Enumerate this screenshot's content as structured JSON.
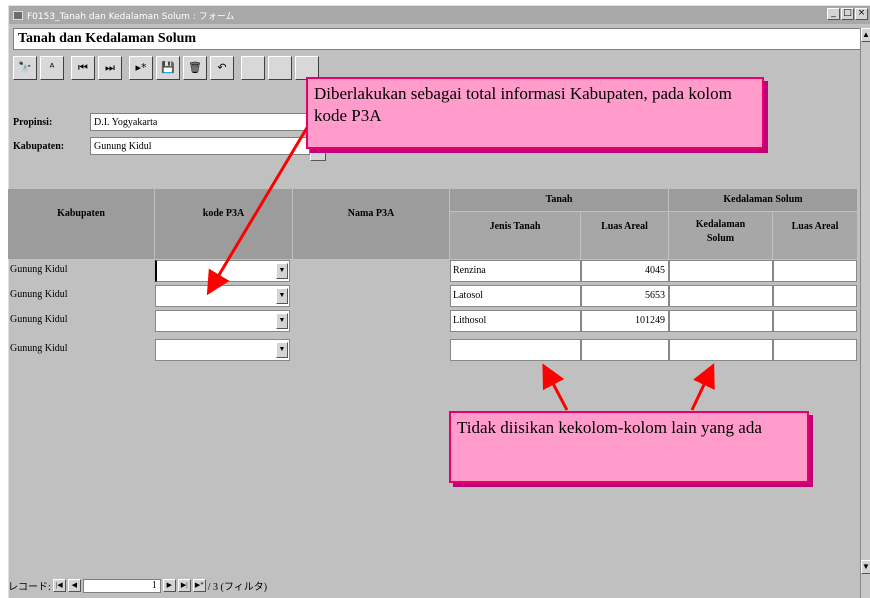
{
  "window": {
    "title": "F0153_Tanah dan Kedalaman Solum : フォーム",
    "min_label": "_",
    "max_label": "□",
    "close_label": "×"
  },
  "form": {
    "title": "Tanah dan Kedalaman Solum"
  },
  "toolbar": {
    "buttons": [
      {
        "name": "find",
        "glyph": "🔭"
      },
      {
        "name": "filter",
        "glyph": "ᴬ"
      },
      {
        "name": "first-record",
        "glyph": "⏮"
      },
      {
        "name": "last-record",
        "glyph": "⏭"
      },
      {
        "name": "new-record",
        "glyph": "▸*"
      },
      {
        "name": "save",
        "glyph": "💾"
      },
      {
        "name": "delete",
        "glyph": "🗑"
      },
      {
        "name": "undo",
        "glyph": "↶"
      },
      {
        "name": "tool-9",
        "glyph": ""
      },
      {
        "name": "tool-10",
        "glyph": ""
      },
      {
        "name": "tool-11",
        "glyph": ""
      }
    ]
  },
  "filters": {
    "propinsi_label": "Propinsi:",
    "propinsi_value": "D.I. Yogyakarta",
    "kabupaten_label": "Kabupaten:",
    "kabupaten_value": "Gunung Kidul"
  },
  "table": {
    "headers": {
      "kabupaten": "Kabupaten",
      "kode_p3a": "kode P3A",
      "nama_p3a": "Nama P3A",
      "tanah": "Tanah",
      "jenis_tanah": "Jenis Tanah",
      "luas_areal_tanah": "Luas Areal",
      "kedalaman_solum": "Kedalaman Solum",
      "kedalaman_solum_sub": "Kedalaman Solum",
      "luas_areal_solum": "Luas Areal"
    },
    "rows": [
      {
        "kabupaten": "Gunung Kidul",
        "kode": "",
        "nama": "",
        "jenis": "Renzina",
        "luas": "4045",
        "kedalaman": "",
        "luas2": ""
      },
      {
        "kabupaten": "Gunung Kidul",
        "kode": "",
        "nama": "",
        "jenis": "Latosol",
        "luas": "5653",
        "kedalaman": "",
        "luas2": ""
      },
      {
        "kabupaten": "Gunung Kidul",
        "kode": "",
        "nama": "",
        "jenis": "Lithosol",
        "luas": "101249",
        "kedalaman": "",
        "luas2": ""
      },
      {
        "kabupaten": "Gunung Kidul",
        "kode": "",
        "nama": "",
        "jenis": "",
        "luas": "",
        "kedalaman": "",
        "luas2": ""
      }
    ]
  },
  "callouts": {
    "top": "Diberlakukan sebagai total informasi Kabupaten, pada kolom kode P3A",
    "bottom": "Tidak diisikan kekolom-kolom lain yang ada"
  },
  "navigator": {
    "label": "レコード:",
    "current": "1",
    "total_text": "/ 3 (フィルタ)"
  },
  "colors": {
    "callout_fill": "#ff9ccc",
    "callout_border": "#e8006a",
    "arrow": "#ff0000",
    "header_gray": "#9c9c9c"
  }
}
